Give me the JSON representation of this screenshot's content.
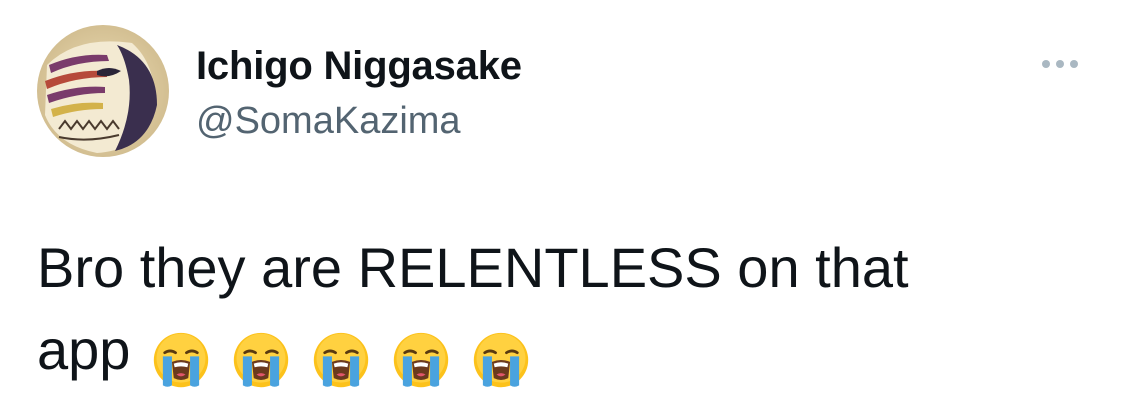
{
  "tweet": {
    "author": {
      "display_name": "Ichigo Niggasake",
      "handle": "@SomaKazima",
      "avatar_icon": "hollow-mask-avatar"
    },
    "more_icon": "more-options-ellipsis-icon",
    "text": {
      "line1": "Bro they are RELENTLESS on that",
      "line2": "app"
    },
    "emojis": [
      {
        "name": "loudly-crying-face-emoji"
      },
      {
        "name": "loudly-crying-face-emoji"
      },
      {
        "name": "loudly-crying-face-emoji"
      },
      {
        "name": "loudly-crying-face-emoji"
      },
      {
        "name": "loudly-crying-face-emoji"
      }
    ]
  },
  "colors": {
    "text_primary": "#0f1419",
    "text_secondary": "#536471",
    "more_dots": "#aab8c2",
    "background": "#ffffff"
  }
}
